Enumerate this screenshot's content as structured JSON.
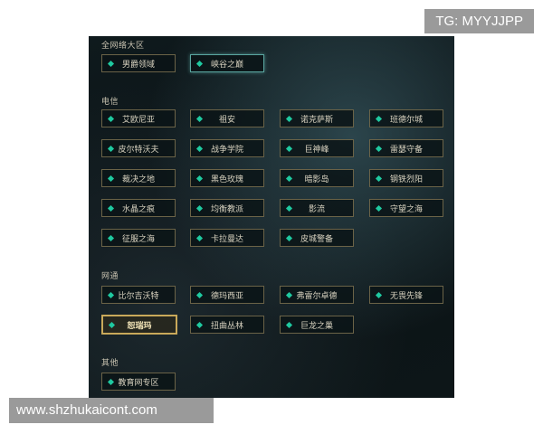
{
  "watermark_top": "TG: MYYJJPP",
  "watermark_bottom": "www.shzhukaicont.com",
  "sections": {
    "all": {
      "label": "全网络大区",
      "servers": [
        "男爵领域",
        "峡谷之巅"
      ]
    },
    "telecom": {
      "label": "电信",
      "servers": [
        "艾欧尼亚",
        "祖安",
        "诺克萨斯",
        "班德尔城",
        "皮尔特沃夫",
        "战争学院",
        "巨神峰",
        "雷瑟守备",
        "裁决之地",
        "黑色玫瑰",
        "暗影岛",
        "钢铁烈阳",
        "水晶之痕",
        "均衡教派",
        "影流",
        "守望之海",
        "征服之海",
        "卡拉曼达",
        "皮城警备"
      ]
    },
    "netcom": {
      "label": "网通",
      "servers": [
        "比尔吉沃特",
        "德玛西亚",
        "弗雷尔卓德",
        "无畏先锋",
        "恕瑞玛",
        "扭曲丛林",
        "巨龙之巢"
      ]
    },
    "other": {
      "label": "其他",
      "servers": [
        "教育网专区"
      ]
    }
  },
  "selected_server": "恕瑞玛",
  "colors": {
    "accent": "#1fc9a0",
    "border": "#6b6347",
    "selected_border": "#c9a95a"
  }
}
